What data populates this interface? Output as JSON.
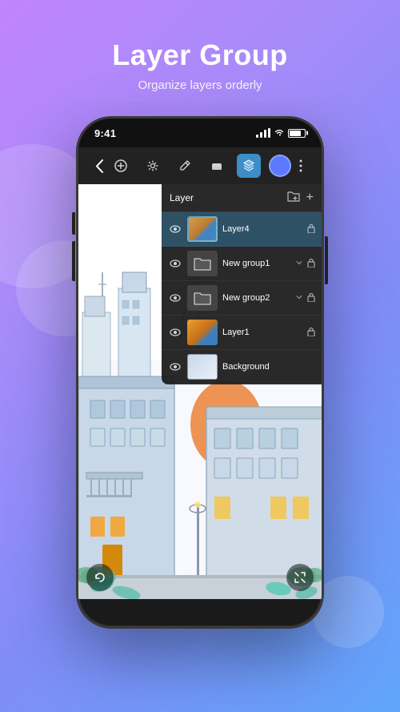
{
  "header": {
    "title": "Layer Group",
    "subtitle": "Organize layers orderly"
  },
  "phone": {
    "time": "9:41",
    "toolbar": {
      "back_icon": "‹",
      "add_icon": "+",
      "settings_icon": "⚙",
      "pencil_icon": "✏",
      "eraser_icon": "◻",
      "layers_icon": "▣",
      "brush_icon": "●",
      "more_icon": "⋮"
    },
    "layer_panel": {
      "title": "Layer",
      "add_folder_icon": "📁",
      "add_layer_icon": "+",
      "layers": [
        {
          "name": "Layer4",
          "visible": true,
          "locked": true,
          "active": true,
          "type": "layer"
        },
        {
          "name": "New group1",
          "visible": true,
          "locked": true,
          "active": false,
          "type": "group"
        },
        {
          "name": "New group2",
          "visible": true,
          "locked": true,
          "active": false,
          "type": "group"
        },
        {
          "name": "Layer1",
          "visible": true,
          "locked": true,
          "active": false,
          "type": "layer"
        },
        {
          "name": "Background",
          "visible": true,
          "locked": false,
          "active": false,
          "type": "layer"
        }
      ]
    },
    "bottom_buttons": {
      "undo_icon": "↺",
      "expand_icon": "⤢"
    }
  }
}
